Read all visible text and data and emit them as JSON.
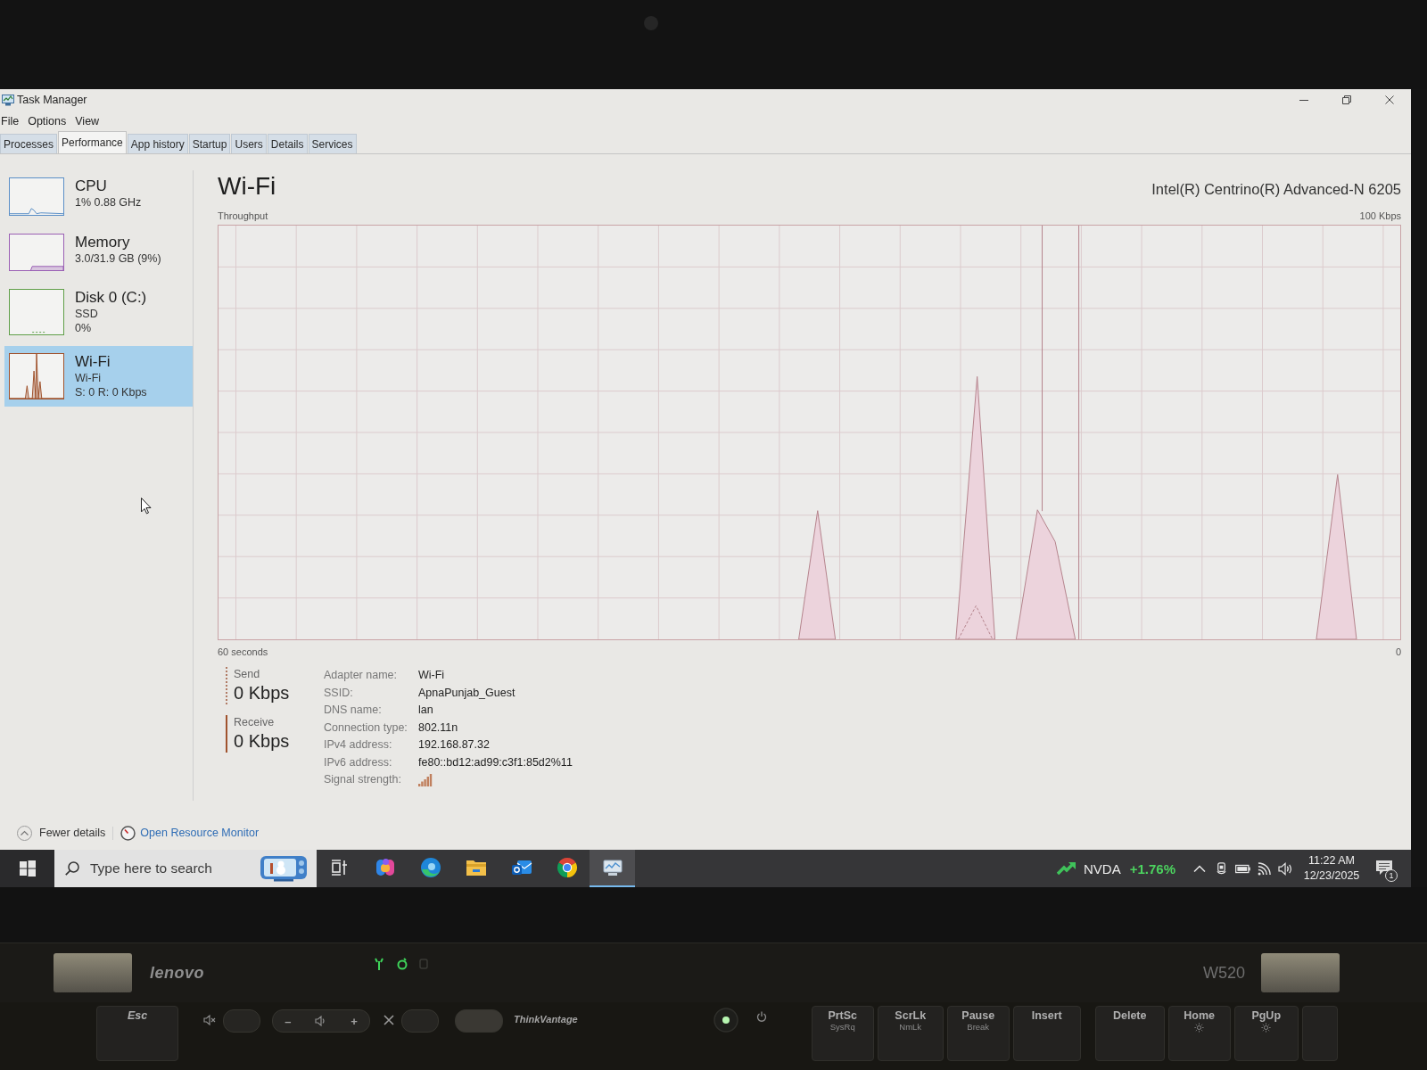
{
  "window": {
    "title": "Task Manager",
    "menu": [
      "File",
      "Options",
      "View"
    ]
  },
  "tabs": [
    {
      "label": "Processes",
      "selected": false
    },
    {
      "label": "Performance",
      "selected": true
    },
    {
      "label": "App history",
      "selected": false
    },
    {
      "label": "Startup",
      "selected": false
    },
    {
      "label": "Users",
      "selected": false
    },
    {
      "label": "Details",
      "selected": false
    },
    {
      "label": "Services",
      "selected": false
    }
  ],
  "sidebar": {
    "items": [
      {
        "kind": "cpu",
        "name": "CPU",
        "details": [
          "1% 0.88 GHz"
        ],
        "color": "#5b8fc7",
        "selected": false
      },
      {
        "kind": "memory",
        "name": "Memory",
        "details": [
          "3.0/31.9 GB (9%)"
        ],
        "color": "#9a5fb4",
        "selected": false
      },
      {
        "kind": "disk",
        "name": "Disk 0 (C:)",
        "details": [
          "SSD",
          "0%"
        ],
        "color": "#5f9e48",
        "selected": false
      },
      {
        "kind": "wifi",
        "name": "Wi-Fi",
        "details": [
          "Wi-Fi",
          "S: 0 R: 0 Kbps"
        ],
        "color": "#a0522d",
        "selected": true
      }
    ]
  },
  "performance": {
    "title": "Wi-Fi",
    "adapter": "Intel(R) Centrino(R) Advanced-N 6205",
    "chart_caption": "Throughput",
    "y_max_label": "100 Kbps",
    "x_start_label": "60 seconds",
    "x_end_label": "0",
    "rates": [
      {
        "kind": "send",
        "label": "Send",
        "value": "0 Kbps"
      },
      {
        "kind": "receive",
        "label": "Receive",
        "value": "0 Kbps"
      }
    ],
    "properties": [
      {
        "kind": "text",
        "label": "Adapter name:",
        "value": "Wi-Fi"
      },
      {
        "kind": "text",
        "label": "SSID:",
        "value": "ApnaPunjab_Guest"
      },
      {
        "kind": "text",
        "label": "DNS name:",
        "value": "lan"
      },
      {
        "kind": "text",
        "label": "Connection type:",
        "value": "802.11n"
      },
      {
        "kind": "text",
        "label": "IPv4 address:",
        "value": "192.168.87.32"
      },
      {
        "kind": "text",
        "label": "IPv6 address:",
        "value": "fe80::bd12:ad99:c3f1:85d2%11"
      },
      {
        "kind": "signal",
        "label": "Signal strength:"
      }
    ]
  },
  "footer": {
    "fewer_details": "Fewer details",
    "resource_monitor": "Open Resource Monitor"
  },
  "taskbar": {
    "search_placeholder": "Type here to search",
    "apps": [
      {
        "kind": "task-view",
        "selected": false
      },
      {
        "kind": "swirl",
        "selected": false
      },
      {
        "kind": "wave",
        "selected": false
      },
      {
        "kind": "folder",
        "selected": false
      },
      {
        "kind": "mail",
        "selected": false
      },
      {
        "kind": "ring",
        "selected": false
      },
      {
        "kind": "monitor",
        "selected": true
      }
    ],
    "stock": {
      "ticker": "NVDA",
      "change": "+1.76%"
    },
    "clock": {
      "time": "11:22 AM",
      "date": "12/23/2025"
    },
    "notification_count": "1"
  },
  "laptop": {
    "brand": "lenovo",
    "model": "W520",
    "esc_key": "Esc",
    "volume_down": "–",
    "volume_up": "+",
    "thinkvantage": "ThinkVantage",
    "keys": [
      {
        "kind": "text",
        "label": "PrtSc",
        "sub": "SysRq"
      },
      {
        "kind": "text",
        "label": "ScrLk",
        "sub": "NmLk"
      },
      {
        "kind": "text",
        "label": "Pause",
        "sub": "Break"
      },
      {
        "kind": "text",
        "label": "Insert"
      },
      {
        "kind": "text",
        "label": "Delete"
      },
      {
        "kind": "brightness",
        "label": "Home"
      },
      {
        "kind": "brightness",
        "label": "PgUp"
      }
    ]
  }
}
